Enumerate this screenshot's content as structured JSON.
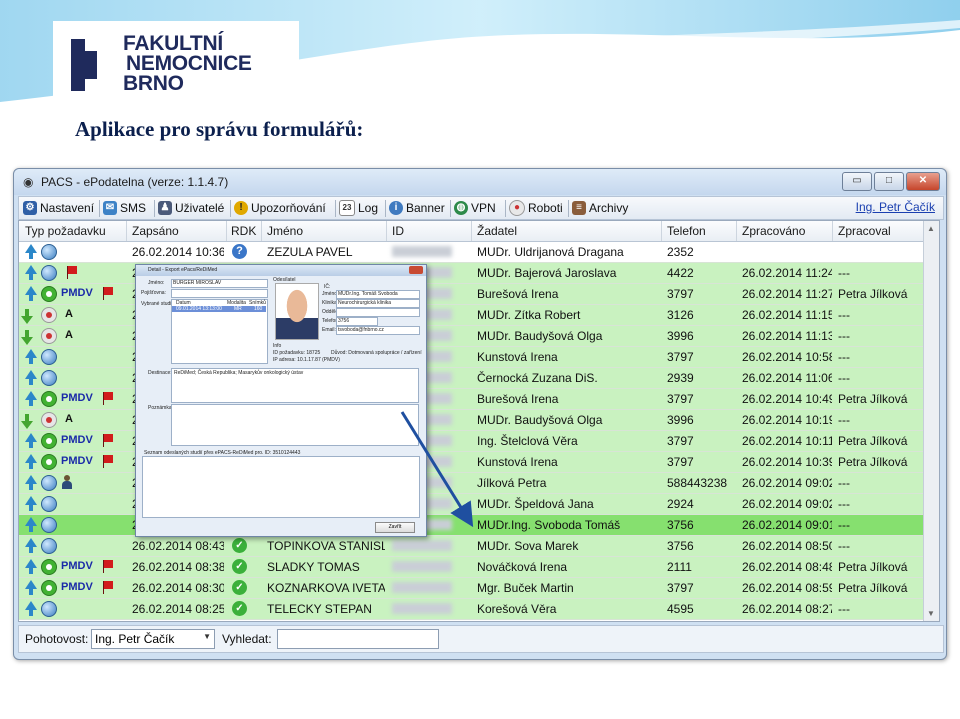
{
  "brand": {
    "line1": "FAKULTNÍ",
    "line2": "NEMOCNICE",
    "line3": "BRNO"
  },
  "slide_title": "Aplikace pro správu formulářů:",
  "window": {
    "title": "PACS - ePodatelna (verze: 1.1.4.7)",
    "controls": {
      "minimize": "▭",
      "maximize": "□",
      "close": "✕"
    }
  },
  "toolbar": {
    "items": [
      "Nastavení",
      "SMS",
      "Uživatelé",
      "Upozorňování",
      "Log",
      "Banner",
      "VPN",
      "Roboti",
      "Archivy"
    ],
    "user_link": "Ing. Petr Čačík"
  },
  "grid": {
    "columns": [
      "Typ požadavku",
      "Zapsáno",
      "RDK",
      "Jméno",
      "ID",
      "Žadatel",
      "Telefon",
      "Zpracováno",
      "Zpracoval"
    ],
    "rows": [
      {
        "dir": "up",
        "status": "globe",
        "tag": "",
        "flag": false,
        "zapsano": "26.02.2014 10:36",
        "rdk": "?",
        "jmeno": "ZEZULA PAVEL",
        "zadatel": "MUDr. Uldrijanová Dragana",
        "telefon": "2352",
        "zpracovano": "",
        "zpracoval": "",
        "bg": "#ffffff"
      },
      {
        "dir": "up",
        "status": "globe",
        "tag": "",
        "flag": true,
        "zapsano": "2",
        "rdk": "",
        "jmeno": "",
        "zadatel": "MUDr. Bajerová Jaroslava",
        "telefon": "4422",
        "zpracovano": "26.02.2014 11:24",
        "zpracoval": "---",
        "bg": "#c9f2c0"
      },
      {
        "dir": "up",
        "status": "green",
        "tag": "PMDV",
        "flag": true,
        "zapsano": "2",
        "rdk": "",
        "jmeno": "",
        "zadatel": "Burešová Irena",
        "telefon": "3797",
        "zpracovano": "26.02.2014 11:27",
        "zpracoval": "Petra Jílková",
        "bg": "#c9f2c0"
      },
      {
        "dir": "down",
        "status": "grey",
        "tag": "A",
        "flag": false,
        "zapsano": "2",
        "rdk": "",
        "jmeno": "",
        "zadatel": "MUDr. Zítka Robert",
        "telefon": "3126",
        "zpracovano": "26.02.2014 11:15",
        "zpracoval": "---",
        "bg": "#c9f2c0"
      },
      {
        "dir": "down",
        "status": "grey",
        "tag": "A",
        "flag": false,
        "zapsano": "2",
        "rdk": "",
        "jmeno": "",
        "zadatel": "MUDr. Baudyšová Olga",
        "telefon": "3996",
        "zpracovano": "26.02.2014 11:13",
        "zpracoval": "---",
        "bg": "#c9f2c0"
      },
      {
        "dir": "up",
        "status": "globe",
        "tag": "",
        "flag": false,
        "zapsano": "2",
        "rdk": "",
        "jmeno": "",
        "zadatel": "Kunstová Irena",
        "telefon": "3797",
        "zpracovano": "26.02.2014 10:58",
        "zpracoval": "---",
        "bg": "#c9f2c0"
      },
      {
        "dir": "up",
        "status": "globe",
        "tag": "",
        "flag": false,
        "zapsano": "2",
        "rdk": "",
        "jmeno": "",
        "zadatel": "Černocká Zuzana DiS.",
        "telefon": "2939",
        "zpracovano": "26.02.2014 11:06",
        "zpracoval": "---",
        "bg": "#c9f2c0"
      },
      {
        "dir": "up",
        "status": "green",
        "tag": "PMDV",
        "flag": true,
        "zapsano": "2",
        "rdk": "",
        "jmeno": "",
        "zadatel": "Burešová Irena",
        "telefon": "3797",
        "zpracovano": "26.02.2014 10:49",
        "zpracoval": "Petra Jílková",
        "bg": "#c9f2c0"
      },
      {
        "dir": "down",
        "status": "grey",
        "tag": "A",
        "flag": false,
        "zapsano": "2",
        "rdk": "",
        "jmeno": "",
        "zadatel": "MUDr. Baudyšová Olga",
        "telefon": "3996",
        "zpracovano": "26.02.2014 10:19",
        "zpracoval": "---",
        "bg": "#c9f2c0"
      },
      {
        "dir": "up",
        "status": "green",
        "tag": "PMDV",
        "flag": true,
        "zapsano": "2",
        "rdk": "",
        "jmeno": "",
        "zadatel": "Ing. Štelclová Věra",
        "telefon": "3797",
        "zpracovano": "26.02.2014 10:11",
        "zpracoval": "Petra Jílková",
        "bg": "#c9f2c0"
      },
      {
        "dir": "up",
        "status": "green",
        "tag": "PMDV",
        "flag": true,
        "zapsano": "2",
        "rdk": "",
        "jmeno": "",
        "zadatel": "Kunstová Irena",
        "telefon": "3797",
        "zpracovano": "26.02.2014 10:39",
        "zpracoval": "Petra Jílková",
        "bg": "#c9f2c0"
      },
      {
        "dir": "up",
        "status": "globe",
        "tag": "person",
        "flag": false,
        "zapsano": "2",
        "rdk": "",
        "jmeno": "",
        "zadatel": "Jílková Petra",
        "telefon": "588443238",
        "zpracovano": "26.02.2014 09:02",
        "zpracoval": "---",
        "bg": "#c9f2c0"
      },
      {
        "dir": "up",
        "status": "globe",
        "tag": "",
        "flag": false,
        "zapsano": "2",
        "rdk": "",
        "jmeno": "",
        "zadatel": "MUDr. Špeldová Jana",
        "telefon": "2924",
        "zpracovano": "26.02.2014 09:02",
        "zpracoval": "---",
        "bg": "#c9f2c0"
      },
      {
        "dir": "up",
        "status": "globe",
        "tag": "",
        "flag": false,
        "zapsano": "2",
        "rdk": "",
        "jmeno": "",
        "zadatel": "MUDr.Ing. Svoboda Tomáš",
        "telefon": "3756",
        "zpracovano": "26.02.2014 09:01",
        "zpracoval": "---",
        "bg": "#86e06f"
      },
      {
        "dir": "up",
        "status": "globe",
        "tag": "",
        "flag": false,
        "zapsano": "26.02.2014 08:43",
        "rdk": "ok",
        "jmeno": "TOPINKOVA STANISL...",
        "zadatel": "MUDr. Sova Marek",
        "telefon": "3756",
        "zpracovano": "26.02.2014 08:50",
        "zpracoval": "---",
        "bg": "#c9f2c0"
      },
      {
        "dir": "up",
        "status": "green",
        "tag": "PMDV",
        "flag": true,
        "zapsano": "26.02.2014 08:38",
        "rdk": "ok",
        "jmeno": "SLADKY TOMAS",
        "zadatel": "Nováčková Irena",
        "telefon": "2111",
        "zpracovano": "26.02.2014 08:48",
        "zpracoval": "Petra Jílková",
        "bg": "#c9f2c0"
      },
      {
        "dir": "up",
        "status": "green",
        "tag": "PMDV",
        "flag": true,
        "zapsano": "26.02.2014 08:30",
        "rdk": "ok",
        "jmeno": "KOZNARKOVA IVETA",
        "zadatel": "Mgr. Buček Martin",
        "telefon": "3797",
        "zpracovano": "26.02.2014 08:59",
        "zpracoval": "Petra Jílková",
        "bg": "#c9f2c0"
      },
      {
        "dir": "up",
        "status": "globe",
        "tag": "",
        "flag": false,
        "zapsano": "26.02.2014 08:25",
        "rdk": "ok",
        "jmeno": "TELECKY STEPAN",
        "zadatel": "Korešová Věra",
        "telefon": "4595",
        "zpracovano": "26.02.2014 08:27",
        "zpracoval": "---",
        "bg": "#c9f2c0"
      }
    ]
  },
  "statusbar": {
    "pohotovost_label": "Pohotovost:",
    "pohotovost_value": "Ing. Petr Čačík",
    "search_label": "Vyhledat:"
  },
  "popup": {
    "title": "Detail - Export ePacs/ReDiMed",
    "jmeno_label": "Jméno:",
    "jmeno_value": "BURGER MIROSLAV",
    "pojistovna_label": "Pojišťovna:",
    "odesilatel_label": "Odesílatel",
    "vybrane_studie_label": "Vybrané studie",
    "col_datum": "Datum",
    "col_modalita": "Modalita",
    "col_snimku": "Snímků",
    "study_row": "09.01.2014 13:13:00",
    "study_mod": "MR",
    "study_cnt": "160",
    "ic_label": "IČ:",
    "jmeno2_label": "Jméno:",
    "jmeno2_value": "MUDr.Ing. Tomáš Svoboda",
    "klinika_label": "Klinika:",
    "klinika_value": "Neurochirurgická klinika",
    "oddel_label": "Oddělení:",
    "telefon_label": "Telefon:",
    "telefon_value": "3756",
    "email_label": "Email:",
    "email_value": "tsvoboda@fnbrno.cz",
    "info_label": "Info",
    "id_pozadavku": "ID požadavku: 18725",
    "duvod": "Důvod: Dotmovaná spolupráce / zařízení",
    "ip_adresa": "IP adresa: 10.1.17.87 (PMDV)",
    "destinace_label": "Destinace:",
    "destinace_value": "ReDiMed; Česká Republika; Masarykův onkologický ústav",
    "poznamka_label": "Poznámka:",
    "seznam_label": "Seznam odeslaných studií přes ePACS-ReDiMed pro. ID: 3510124443",
    "zavrit": "Zavřít"
  }
}
